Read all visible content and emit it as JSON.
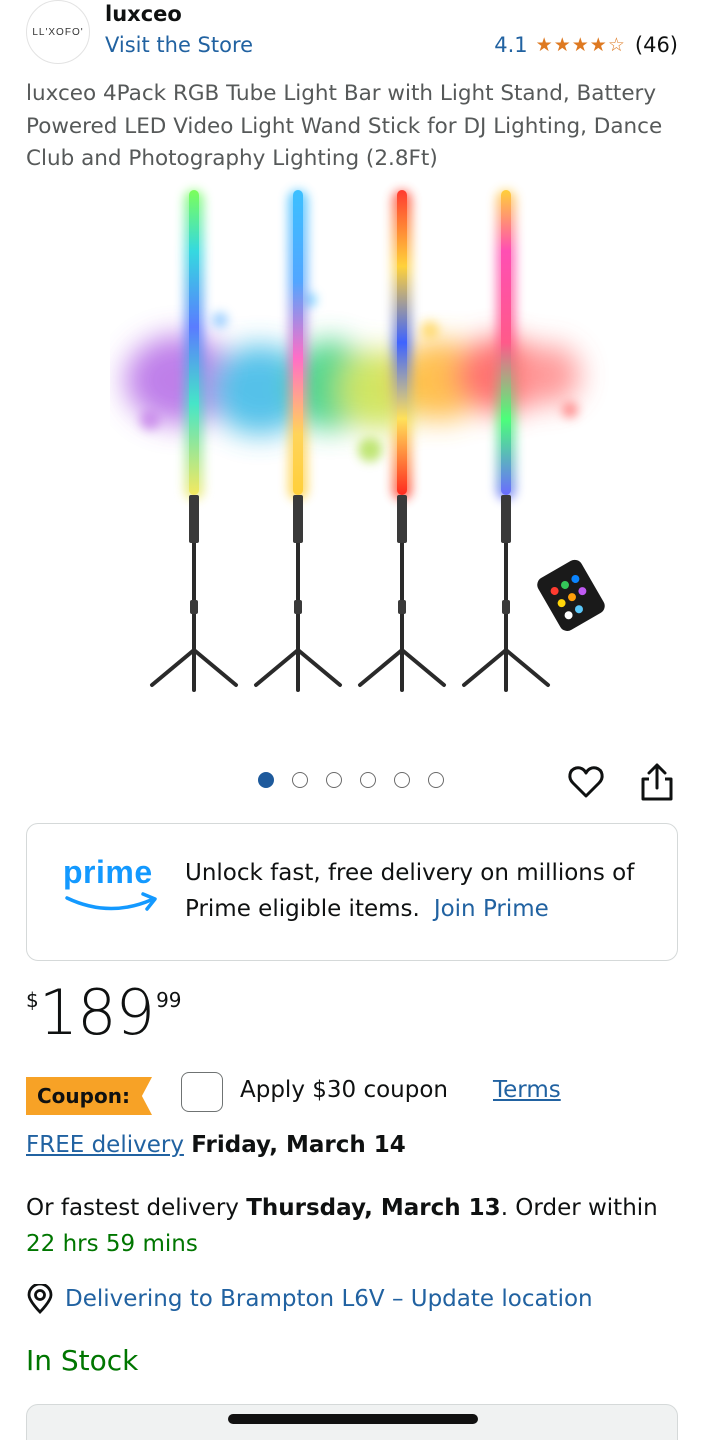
{
  "store": {
    "logo_text": "LL'XOFO'",
    "brand_name": "luxceo",
    "visit_label": "Visit the Store"
  },
  "rating": {
    "value": "4.1",
    "stars": 4.1,
    "count": "(46)",
    "star_color": "#de7921"
  },
  "product": {
    "title": "luxceo 4Pack RGB Tube Light Bar with Light Stand, Battery Powered LED Video Light Wand Stick for DJ Lighting, Dance Club and Photography Lighting (2.8Ft)",
    "image_icon": "rgb-tube-lights-on-tripods-image"
  },
  "carousel": {
    "total": 6,
    "active": 1
  },
  "actions": {
    "heart_icon": "heart-icon",
    "share_icon": "share-icon"
  },
  "prime": {
    "logo_text": "prime",
    "message": "Unlock fast, free delivery on millions of Prime eligible items.",
    "link_label": "Join Prime",
    "brand_color": "#1399ff"
  },
  "price": {
    "symbol": "$",
    "whole": "189",
    "fraction": "99"
  },
  "coupon": {
    "badge_label": "Coupon:",
    "apply_text": "Apply $30 coupon",
    "terms_label": "Terms",
    "badge_color": "#f7a226"
  },
  "delivery": {
    "free_label": "FREE delivery",
    "free_date": "Friday, March 14",
    "fastest_prefix": "Or fastest delivery",
    "fastest_date": "Thursday, March 13",
    "order_within": ". Order within",
    "countdown": "22 hrs 59 mins",
    "location_text": "Delivering to Brampton L6V – Update location"
  },
  "stock": {
    "status": "In Stock"
  },
  "colors": {
    "link": "#2162a1",
    "green": "#007600",
    "text": "#0f1111",
    "muted": "#565959"
  }
}
